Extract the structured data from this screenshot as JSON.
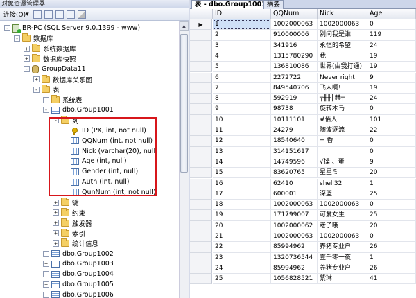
{
  "object_explorer": {
    "title": "对象资源管理器",
    "toolbar": {
      "connect_label": "连接(O)",
      "connect_arrow": "▾"
    },
    "tree": [
      {
        "label": "BR-PC (SQL Server 9.0.1399 - www)",
        "icon": "server-icon",
        "level": 0,
        "expander": "-"
      },
      {
        "label": "数据库",
        "icon": "folder-icon",
        "level": 1,
        "expander": "-"
      },
      {
        "label": "系统数据库",
        "icon": "folder-icon",
        "level": 2,
        "expander": "+"
      },
      {
        "label": "数据库快照",
        "icon": "folder-icon",
        "level": 2,
        "expander": "+"
      },
      {
        "label": "GroupData11",
        "icon": "database-icon",
        "level": 2,
        "expander": "-"
      },
      {
        "label": "数据库关系图",
        "icon": "folder-icon",
        "level": 3,
        "expander": "+"
      },
      {
        "label": "表",
        "icon": "folder-icon",
        "level": 3,
        "expander": "-"
      },
      {
        "label": "系统表",
        "icon": "folder-icon",
        "level": 4,
        "expander": "+"
      },
      {
        "label": "dbo.Group1001",
        "icon": "table-icon",
        "level": 4,
        "expander": "-"
      },
      {
        "label": "列",
        "icon": "folder-icon",
        "level": 5,
        "expander": "-"
      },
      {
        "label": "ID (PK, int, not null)",
        "icon": "key-icon",
        "level": 6,
        "expander": ""
      },
      {
        "label": "QQNum (int, not null)",
        "icon": "column-icon",
        "level": 6,
        "expander": ""
      },
      {
        "label": "Nick (varchar(20), null)",
        "icon": "column-icon",
        "level": 6,
        "expander": ""
      },
      {
        "label": "Age (int, null)",
        "icon": "column-icon",
        "level": 6,
        "expander": ""
      },
      {
        "label": "Gender (int, null)",
        "icon": "column-icon",
        "level": 6,
        "expander": ""
      },
      {
        "label": "Auth (int, null)",
        "icon": "column-icon",
        "level": 6,
        "expander": ""
      },
      {
        "label": "QunNum (int, not null)",
        "icon": "column-icon",
        "level": 6,
        "expander": ""
      },
      {
        "label": "键",
        "icon": "folder-icon",
        "level": 5,
        "expander": "+"
      },
      {
        "label": "约束",
        "icon": "folder-icon",
        "level": 5,
        "expander": "+"
      },
      {
        "label": "触发器",
        "icon": "folder-icon",
        "level": 5,
        "expander": "+"
      },
      {
        "label": "索引",
        "icon": "folder-icon",
        "level": 5,
        "expander": "+"
      },
      {
        "label": "统计信息",
        "icon": "folder-icon",
        "level": 5,
        "expander": "+"
      },
      {
        "label": "dbo.Group1002",
        "icon": "table-icon",
        "level": 4,
        "expander": "+"
      },
      {
        "label": "dbo.Group1003",
        "icon": "table-icon",
        "level": 4,
        "expander": "+"
      },
      {
        "label": "dbo.Group1004",
        "icon": "table-icon",
        "level": 4,
        "expander": "+"
      },
      {
        "label": "dbo.Group1005",
        "icon": "table-icon",
        "level": 4,
        "expander": "+"
      },
      {
        "label": "dbo.Group1006",
        "icon": "table-icon",
        "level": 4,
        "expander": "+"
      }
    ]
  },
  "document": {
    "tabs": [
      {
        "label": "表 - dbo.Group1001",
        "active": true
      },
      {
        "label": "摘要",
        "active": false
      }
    ],
    "current_row_marker": "▶",
    "columns": [
      "ID",
      "QQNum",
      "Nick",
      "Age"
    ],
    "rows": [
      [
        "1",
        "1002000063",
        "1002000063",
        "0"
      ],
      [
        "2",
        "910000006",
        "别问我是谁",
        "119"
      ],
      [
        "3",
        "341916",
        "永恒的希望",
        "24"
      ],
      [
        "4",
        "1315780290",
        "我",
        "19"
      ],
      [
        "5",
        "136810086",
        "世界(由我打通)",
        "19"
      ],
      [
        "6",
        "2272722",
        "Never right",
        "9"
      ],
      [
        "7",
        "849540706",
        "飞人啊!",
        "19"
      ],
      [
        "8",
        "592919",
        "╤╫╫┃赫╤",
        "24"
      ],
      [
        "9",
        "98738",
        "旋转木马",
        "0"
      ],
      [
        "10",
        "10111101",
        "#佰人",
        "101"
      ],
      [
        "11",
        "24279",
        "随波逐流",
        "22"
      ],
      [
        "12",
        "18540640",
        "=    香",
        "0"
      ],
      [
        "13",
        "314151617",
        "",
        "0"
      ],
      [
        "14",
        "14749596",
        "√操 、蛋",
        "9"
      ],
      [
        "15",
        "83620765",
        "  星星ミ",
        "20"
      ],
      [
        "16",
        "62410",
        "shell32",
        "1"
      ],
      [
        "17",
        "600001",
        "深蓝",
        "25"
      ],
      [
        "18",
        "1002000063",
        "1002000063",
        "0"
      ],
      [
        "19",
        "171799007",
        "可爱女生",
        "25"
      ],
      [
        "20",
        "1002000062",
        "老子哦",
        "20"
      ],
      [
        "21",
        "1002000063",
        "1002000063",
        "0"
      ],
      [
        "22",
        "85994962",
        "养猪专业户",
        "26"
      ],
      [
        "23",
        "1320736544",
        "壹千零一夜",
        "1"
      ],
      [
        "24",
        "85994962",
        "养猪专业户",
        "26"
      ],
      [
        "25",
        "1056828521",
        "紫琳",
        "41"
      ]
    ]
  }
}
